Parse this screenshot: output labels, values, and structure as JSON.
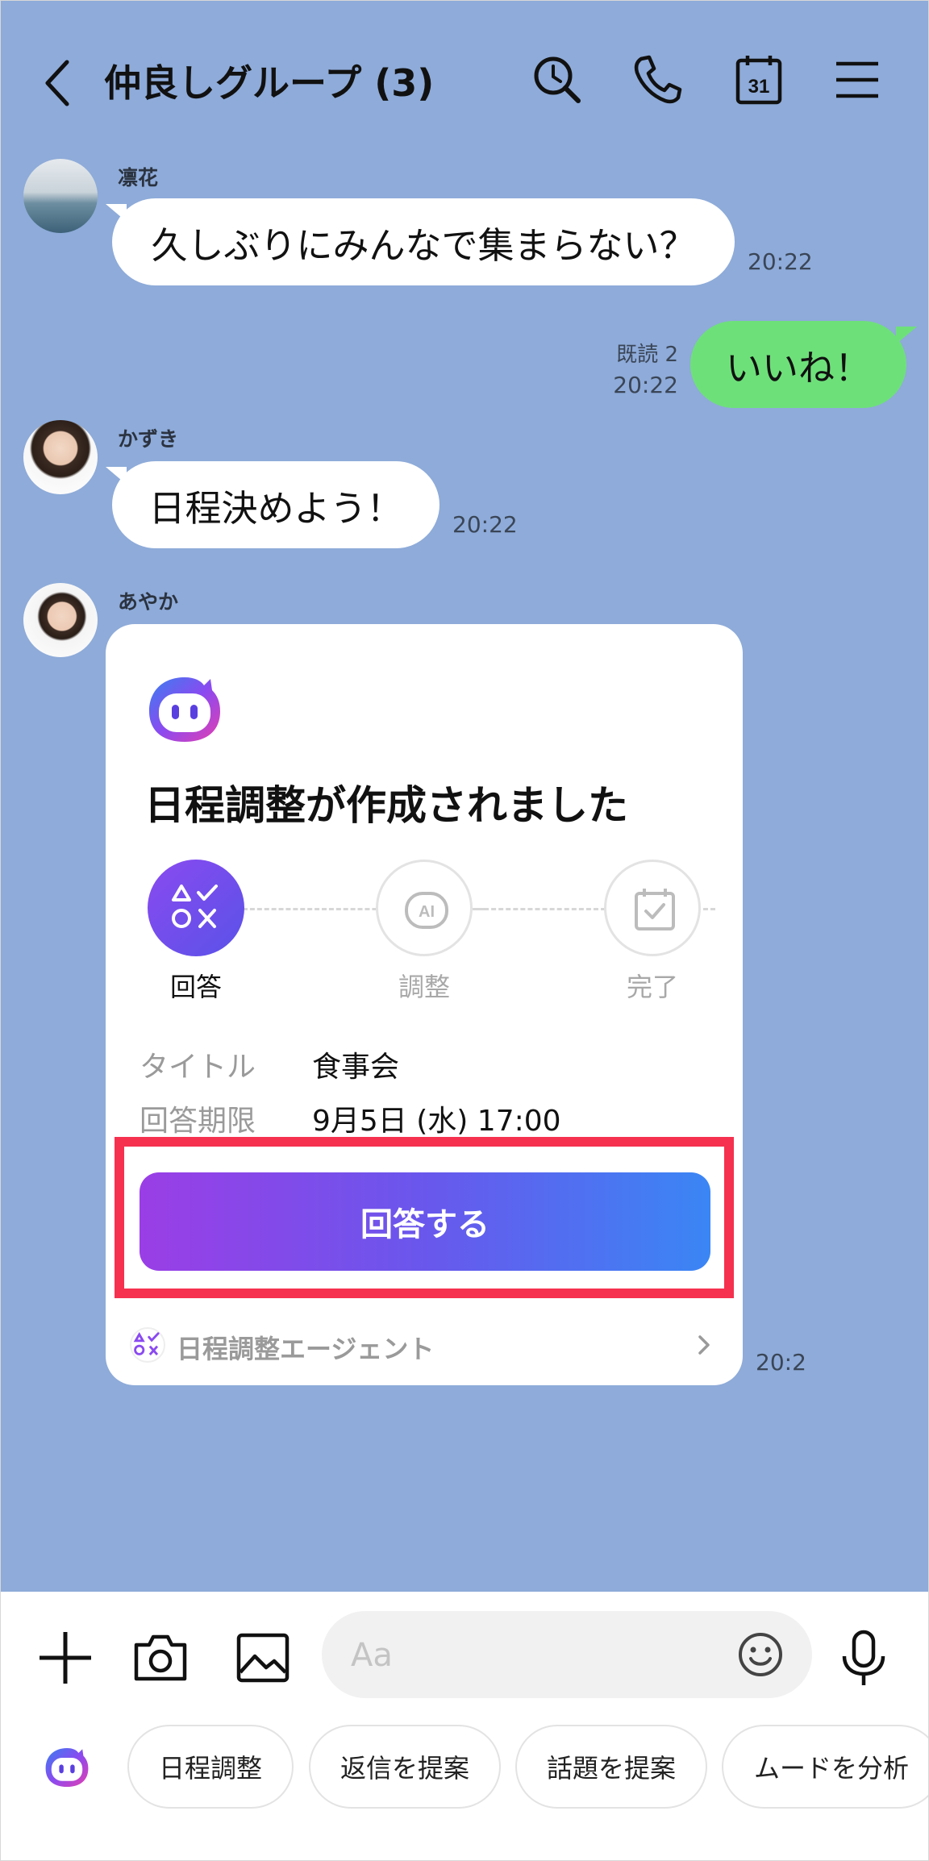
{
  "header": {
    "title": "仲良しグループ (3)"
  },
  "messages": [
    {
      "name": "凛花",
      "text": "久しぶりにみんなで集まらない？",
      "time": "20:22"
    },
    {
      "read": "既読 2",
      "time": "20:22",
      "text": "いいね！"
    },
    {
      "name": "かずき",
      "text": "日程決めよう！",
      "time": "20:22"
    },
    {
      "name": "あやか",
      "time": "20:2"
    }
  ],
  "card": {
    "title": "日程調整が作成されました",
    "steps": [
      {
        "label": "回答",
        "icon": "symbols-icon",
        "active": true
      },
      {
        "label": "調整",
        "icon": "ai-icon",
        "active": false
      },
      {
        "label": "完了",
        "icon": "calendar-check-icon",
        "active": false
      }
    ],
    "rows": [
      {
        "label": "タイトル",
        "value": "食事会"
      },
      {
        "label": "回答期限",
        "value": "9月5日 (水) 17:00"
      }
    ],
    "button_label": "回答する",
    "agent_label": "日程調整エージェント"
  },
  "composer": {
    "placeholder": "Aa"
  },
  "chips": [
    "日程調整",
    "返信を提案",
    "話題を提案",
    "ムードを分析"
  ],
  "colors": {
    "background": "#8eabd9",
    "own_bubble": "#6ee07a",
    "highlight": "#f5314f",
    "button_start": "#9a3ee6",
    "button_end": "#3a86f5"
  }
}
